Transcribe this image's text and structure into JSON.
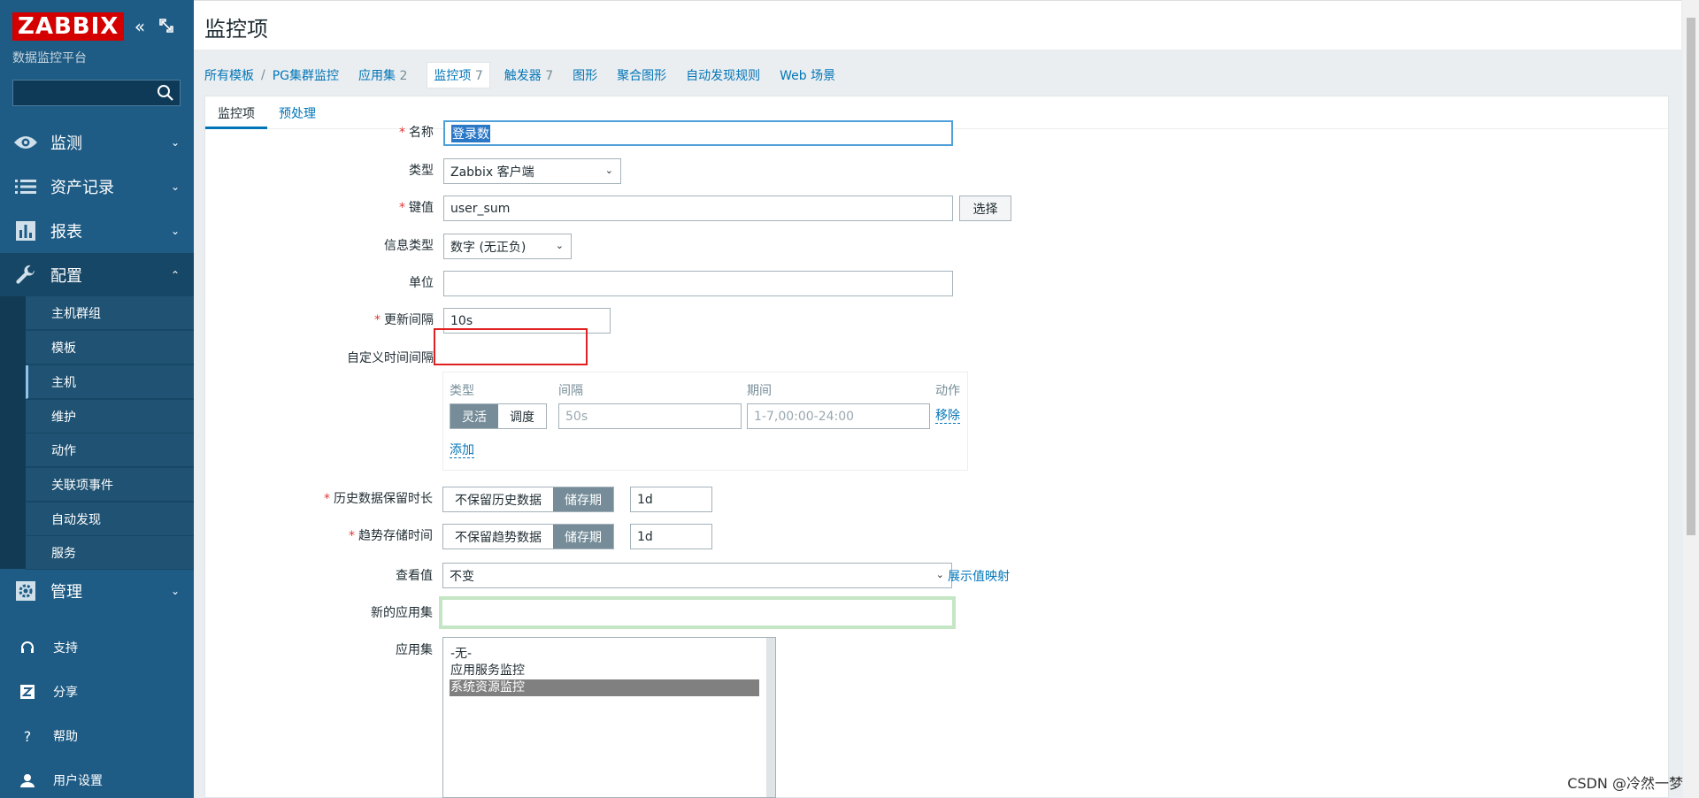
{
  "sidebar": {
    "logo": "ZABBIX",
    "subtitle": "数据监控平台",
    "search_value": "",
    "nav": [
      {
        "label": "监测",
        "icon": "eye-icon"
      },
      {
        "label": "资产记录",
        "icon": "list-icon"
      },
      {
        "label": "报表",
        "icon": "bar-chart-icon"
      },
      {
        "label": "配置",
        "icon": "wrench-icon"
      },
      {
        "label": "管理",
        "icon": "gear-icon"
      }
    ],
    "config_submenu": [
      "主机群组",
      "模板",
      "主机",
      "维护",
      "动作",
      "关联项事件",
      "自动发现",
      "服务"
    ],
    "footer": [
      {
        "label": "支持",
        "icon": "headset-icon"
      },
      {
        "label": "分享",
        "icon": "share-icon"
      },
      {
        "label": "帮助",
        "icon": "help-icon"
      },
      {
        "label": "用户设置",
        "icon": "user-icon"
      }
    ]
  },
  "header": {
    "title": "监控项"
  },
  "breadcrumbs": {
    "all_templates": "所有模板",
    "separator": "/",
    "template": "PG集群监控",
    "applications": {
      "label": "应用集",
      "count": "2"
    },
    "items": {
      "label": "监控项",
      "count": "7"
    },
    "triggers": {
      "label": "触发器",
      "count": "7"
    },
    "graphs": "图形",
    "screens": "聚合图形",
    "discovery": "自动发现规则",
    "web": "Web 场景"
  },
  "tabs": [
    "监控项",
    "预处理"
  ],
  "form": {
    "name_label": "名称",
    "name_value": "登录数",
    "type_label": "类型",
    "type_value": "Zabbix 客户端",
    "key_label": "键值",
    "key_value": "user_sum",
    "key_button": "选择",
    "info_type_label": "信息类型",
    "info_type_value": "数字 (无正负)",
    "units_label": "单位",
    "units_value": "",
    "interval_label": "更新间隔",
    "interval_value": "10s",
    "custom_interval_label": "自定义时间间隔",
    "custom": {
      "head_type": "类型",
      "head_interval": "间隔",
      "head_period": "期间",
      "head_action": "动作",
      "flexible": "灵活",
      "scheduling": "调度",
      "interval_placeholder": "50s",
      "period_placeholder": "1-7,00:00-24:00",
      "remove": "移除",
      "add": "添加"
    },
    "history_label": "历史数据保留时长",
    "history_off": "不保留历史数据",
    "history_on": "储存期",
    "history_value": "1d",
    "trends_label": "趋势存储时间",
    "trends_off": "不保留趋势数据",
    "trends_on": "储存期",
    "trends_value": "1d",
    "valuemap_label": "查看值",
    "valuemap_value": "不变",
    "valuemap_link": "展示值映射",
    "new_app_label": "新的应用集",
    "new_app_value": "",
    "apps_label": "应用集",
    "apps_options": [
      "-无-",
      "应用服务监控",
      "系统资源监控"
    ],
    "apps_selected_index": 2
  },
  "watermark": "CSDN @冷然一梦"
}
